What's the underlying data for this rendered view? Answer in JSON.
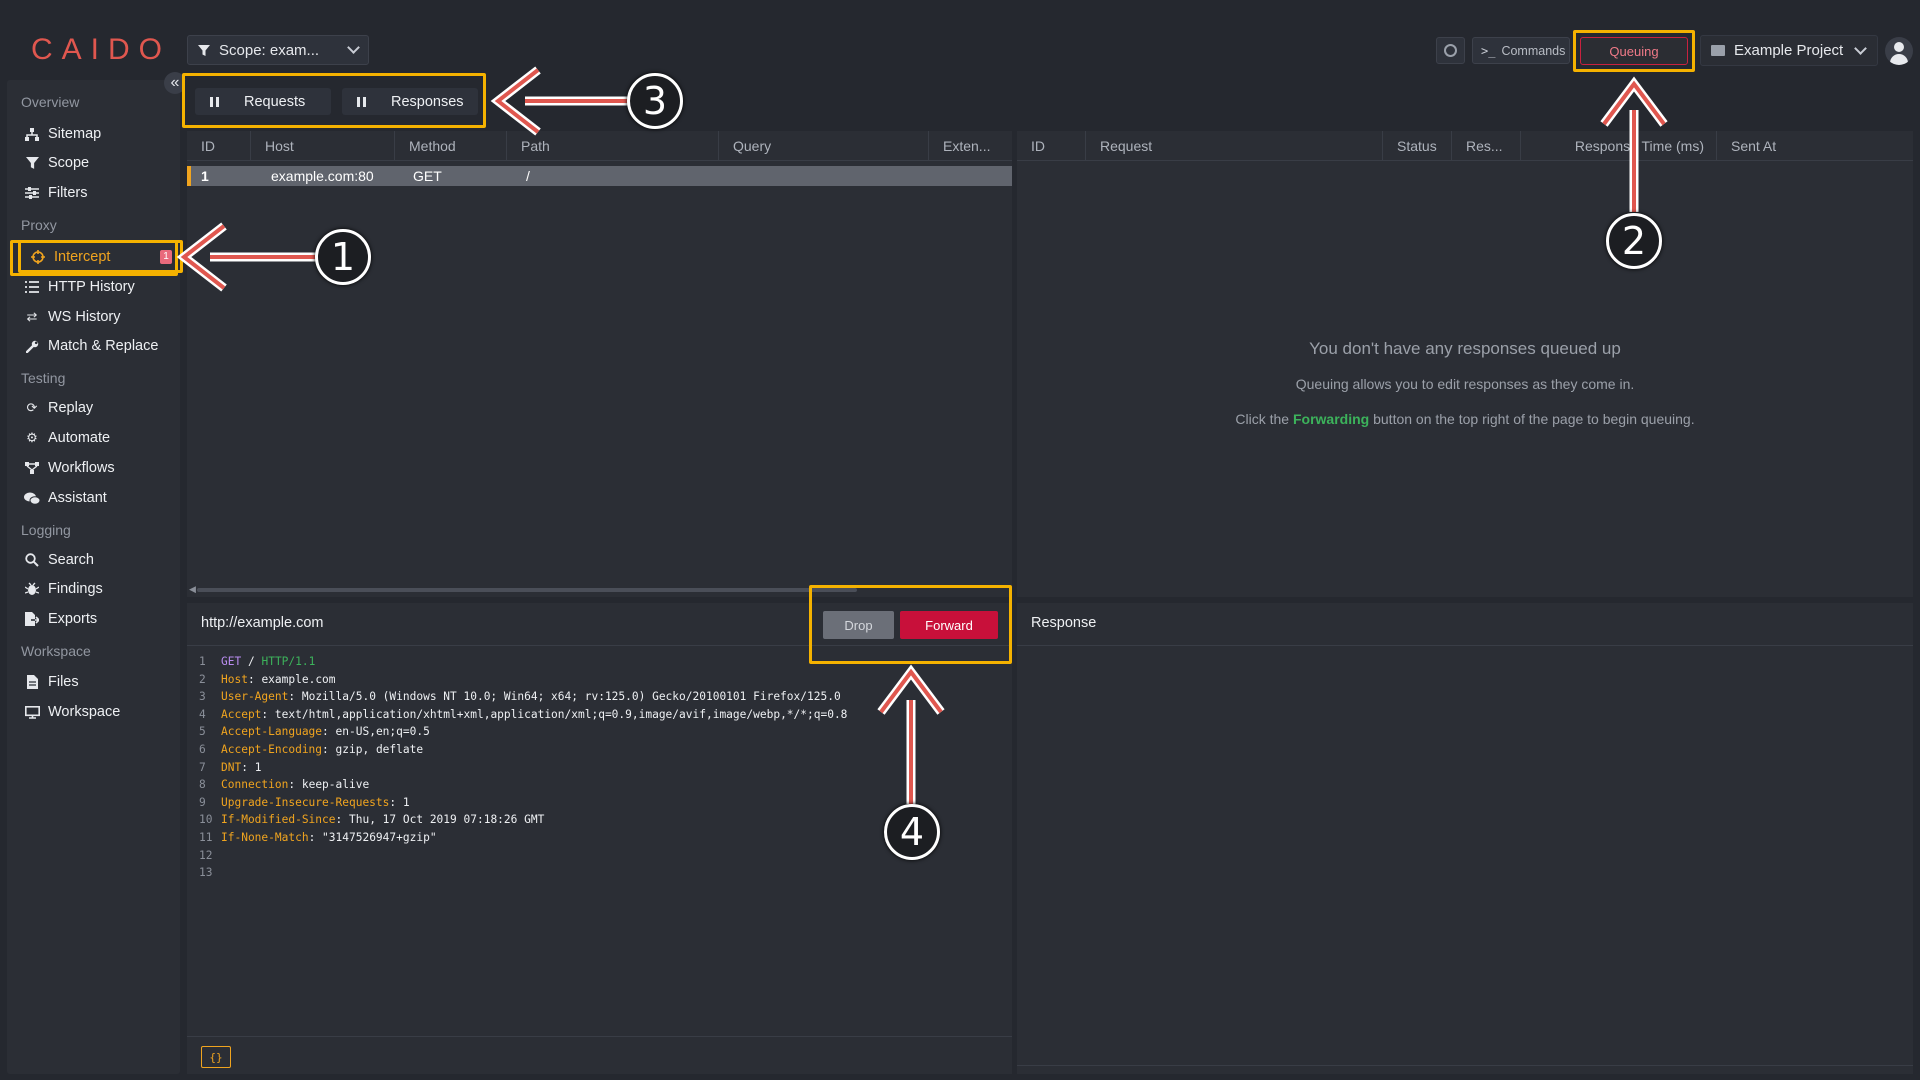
{
  "app": {
    "logo": "CAIDO",
    "scope_label": "Scope: exam...",
    "commands_label": "Commands",
    "queuing_label": "Queuing",
    "project_label": "Example Project",
    "collapse_glyph": "«"
  },
  "sidebar": {
    "sections": {
      "overview": "Overview",
      "proxy": "Proxy",
      "testing": "Testing",
      "logging": "Logging",
      "workspace": "Workspace"
    },
    "items": {
      "sitemap": "Sitemap",
      "scope": "Scope",
      "filters": "Filters",
      "intercept": "Intercept",
      "intercept_badge": "1",
      "http_history": "HTTP History",
      "ws_history": "WS History",
      "match_replace": "Match & Replace",
      "replay": "Replay",
      "automate": "Automate",
      "workflows": "Workflows",
      "assistant": "Assistant",
      "search": "Search",
      "findings": "Findings",
      "exports": "Exports",
      "files": "Files",
      "workspace": "Workspace"
    }
  },
  "toggles": {
    "requests": "Requests",
    "responses": "Responses"
  },
  "request_table": {
    "columns": [
      "ID",
      "Host",
      "Method",
      "Path",
      "Query",
      "Exten..."
    ],
    "rows": [
      {
        "id": "1",
        "host": "example.com:80",
        "method": "GET",
        "path": "/",
        "query": "",
        "ext": ""
      }
    ]
  },
  "response_table": {
    "columns": [
      "ID",
      "Request",
      "Status",
      "Res...",
      "Response Time (ms)",
      "Sent At"
    ],
    "empty_title": "You don't have any responses queued up",
    "empty_line1": "Queuing allows you to edit responses as they come in.",
    "empty_line2_pre": "Click the ",
    "empty_line2_strong": "Forwarding",
    "empty_line2_post": " button on the top right of the page to begin queuing."
  },
  "request_editor": {
    "url": "http://example.com",
    "drop_label": "Drop",
    "forward_label": "Forward",
    "format_label": "{}",
    "request_line": {
      "method": "GET",
      "path": "/",
      "version": "HTTP/1.1"
    },
    "headers": [
      {
        "name": "Host",
        "value": "example.com"
      },
      {
        "name": "User-Agent",
        "value": "Mozilla/5.0 (Windows NT 10.0; Win64; x64; rv:125.0) Gecko/20100101 Firefox/125.0"
      },
      {
        "name": "Accept",
        "value": "text/html,application/xhtml+xml,application/xml;q=0.9,image/avif,image/webp,*/*;q=0.8"
      },
      {
        "name": "Accept-Language",
        "value": "en-US,en;q=0.5"
      },
      {
        "name": "Accept-Encoding",
        "value": "gzip, deflate"
      },
      {
        "name": "DNT",
        "value": "1"
      },
      {
        "name": "Connection",
        "value": "keep-alive"
      },
      {
        "name": "Upgrade-Insecure-Requests",
        "value": "1"
      },
      {
        "name": "If-Modified-Since",
        "value": "Thu, 17 Oct 2019 07:18:26 GMT"
      },
      {
        "name": "If-None-Match",
        "value": "\"3147526947+gzip\""
      }
    ],
    "line_numbers": [
      "1",
      "2",
      "3",
      "4",
      "5",
      "6",
      "7",
      "8",
      "9",
      "10",
      "11",
      "12",
      "13"
    ]
  },
  "response_editor": {
    "title": "Response"
  },
  "annotations": {
    "callout_1": "1",
    "callout_2": "2",
    "callout_3": "3",
    "callout_4": "4",
    "highlight_color": "#f5b200",
    "arrow_color": "#e0574f"
  },
  "colors": {
    "accent_orange": "#f0a41f",
    "forward_red": "#c8103a",
    "forwarding_green": "#3cb35b",
    "background": "#25282f",
    "panel": "#2b2e35"
  }
}
